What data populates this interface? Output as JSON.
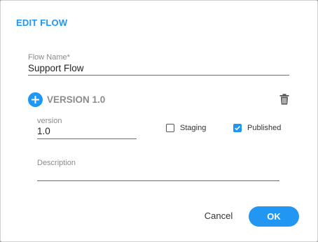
{
  "dialog": {
    "title": "EDIT FLOW"
  },
  "flow_name": {
    "label": "Flow Name*",
    "value": "Support Flow"
  },
  "version_section": {
    "title": "VERSION 1.0",
    "add_icon": "plus-icon",
    "delete_icon": "trash-icon",
    "version_field": {
      "label": "version",
      "value": "1.0"
    },
    "staging": {
      "label": "Staging",
      "checked": false
    },
    "published": {
      "label": "Published",
      "checked": true
    },
    "description": {
      "label": "Description",
      "value": ""
    }
  },
  "actions": {
    "cancel_label": "Cancel",
    "ok_label": "OK"
  },
  "colors": {
    "accent": "#2196f3"
  }
}
